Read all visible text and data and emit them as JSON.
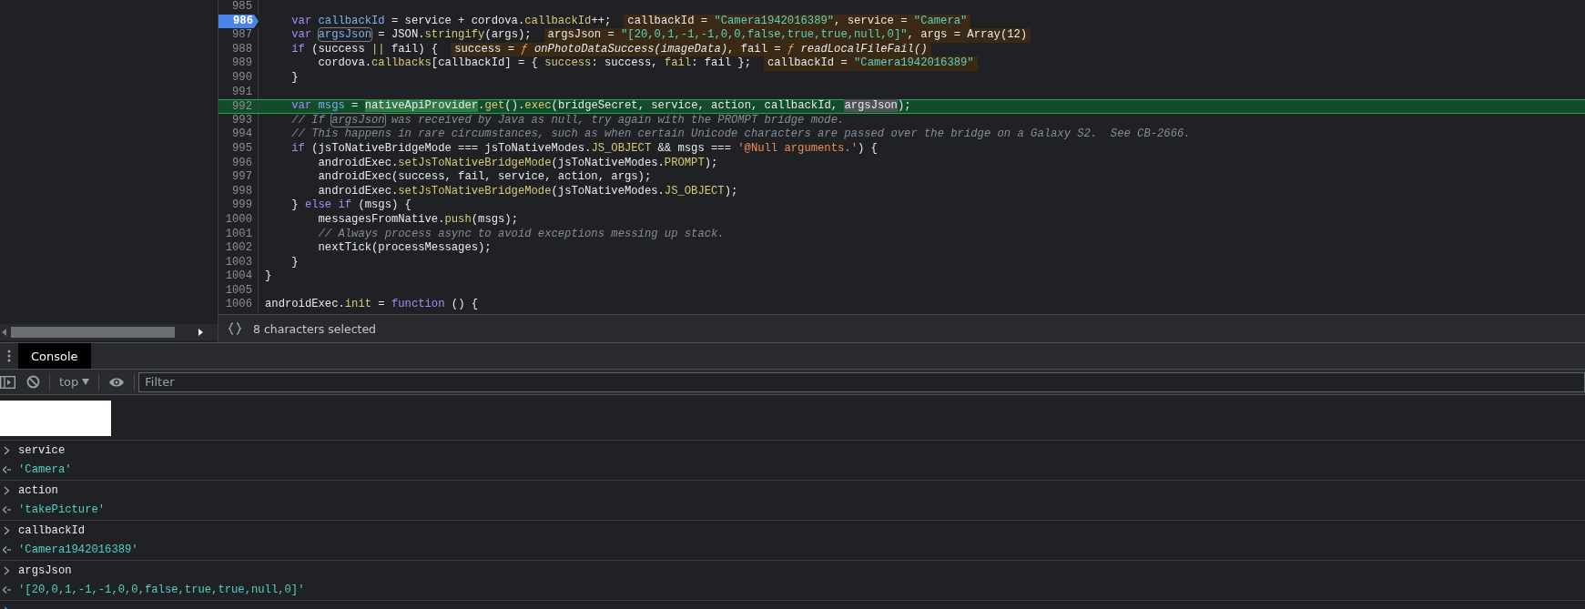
{
  "editor": {
    "lines": [
      {
        "number": "985",
        "breakpoint": false,
        "current": false
      },
      {
        "number": "986",
        "breakpoint": true,
        "current": false,
        "segments": [
          {
            "text": "    var ",
            "kind": "k"
          },
          {
            "text": "callbackId",
            "kind": "d"
          },
          {
            "text": " = service + cordova.",
            "kind": "p"
          },
          {
            "text": "callbackId",
            "kind": "y"
          },
          {
            "text": "++;",
            "kind": "p"
          }
        ],
        "inline": [
          {
            "text": "callbackId = ",
            "kind": "n"
          },
          {
            "text": "\"Camera1942016389\"",
            "kind": "t"
          },
          {
            "text": ", service = ",
            "kind": "n"
          },
          {
            "text": "\"Camera\"",
            "kind": "t"
          }
        ]
      },
      {
        "number": "987",
        "breakpoint": false,
        "current": false,
        "segments": [
          {
            "text": "    var ",
            "kind": "k"
          },
          {
            "text": "argsJson",
            "kind": "dm"
          },
          {
            "text": " = JSON.",
            "kind": "p"
          },
          {
            "text": "stringify",
            "kind": "y"
          },
          {
            "text": "(args);",
            "kind": "p"
          }
        ],
        "inline": [
          {
            "text": "argsJson = ",
            "kind": "n"
          },
          {
            "text": "\"[20,0,1,-1,-1,0,0,false,true,true,null,0]\"",
            "kind": "t"
          },
          {
            "text": ", args = Array(12)",
            "kind": "n"
          }
        ]
      },
      {
        "number": "988",
        "breakpoint": false,
        "current": false,
        "segments": [
          {
            "text": "    if",
            "kind": "k"
          },
          {
            "text": " (success ",
            "kind": "p"
          },
          {
            "text": "||",
            "kind": "y"
          },
          {
            "text": " fail) {",
            "kind": "p"
          }
        ],
        "inline": [
          {
            "text": "success = ",
            "kind": "n"
          },
          {
            "text": "ƒ ",
            "kind": "f"
          },
          {
            "text": "onPhotoDataSuccess(imageData)",
            "kind": "i"
          },
          {
            "text": ", fail = ",
            "kind": "n"
          },
          {
            "text": "ƒ ",
            "kind": "f"
          },
          {
            "text": "readLocalFileFail()",
            "kind": "i"
          }
        ]
      },
      {
        "number": "989",
        "breakpoint": false,
        "current": false,
        "segments": [
          {
            "text": "        cordova.",
            "kind": "p"
          },
          {
            "text": "callbacks",
            "kind": "y"
          },
          {
            "text": "[callbackId] = { ",
            "kind": "p"
          },
          {
            "text": "success",
            "kind": "y"
          },
          {
            "text": ": success, ",
            "kind": "p"
          },
          {
            "text": "fail",
            "kind": "y"
          },
          {
            "text": ": fail };",
            "kind": "p"
          }
        ],
        "inline": [
          {
            "text": "callbackId = ",
            "kind": "n"
          },
          {
            "text": "\"Camera1942016389\"",
            "kind": "t"
          }
        ]
      },
      {
        "number": "990",
        "breakpoint": false,
        "current": false,
        "segments": [
          {
            "text": "    }",
            "kind": "p"
          }
        ]
      },
      {
        "number": "991",
        "breakpoint": false,
        "current": false
      },
      {
        "number": "992",
        "breakpoint": false,
        "current": true,
        "segments": [
          {
            "text": "    var ",
            "kind": "k"
          },
          {
            "text": "msgs",
            "kind": "d"
          },
          {
            "text": " = ",
            "kind": "p"
          },
          {
            "text": "nativeApiProvider",
            "kind": "ph"
          },
          {
            "text": ".",
            "kind": "p"
          },
          {
            "text": "get",
            "kind": "y"
          },
          {
            "text": "().",
            "kind": "p"
          },
          {
            "text": "exec",
            "kind": "y"
          },
          {
            "text": "(bridgeSecret, service, action, callbackId, ",
            "kind": "p"
          },
          {
            "text": "argsJson",
            "kind": "ps"
          },
          {
            "text": ");",
            "kind": "p"
          }
        ]
      },
      {
        "number": "993",
        "breakpoint": false,
        "current": false,
        "segments": [
          {
            "text": "    // If ",
            "kind": "c"
          },
          {
            "text": "argsJson",
            "kind": "cm"
          },
          {
            "text": " was received by Java as null, try again with the PROMPT bridge mode.",
            "kind": "c"
          }
        ]
      },
      {
        "number": "994",
        "breakpoint": false,
        "current": false,
        "segments": [
          {
            "text": "    // This happens in rare circumstances, such as when certain Unicode characters are passed over the bridge on a Galaxy S2.  See CB-2666.",
            "kind": "c"
          }
        ]
      },
      {
        "number": "995",
        "breakpoint": false,
        "current": false,
        "segments": [
          {
            "text": "    if",
            "kind": "k"
          },
          {
            "text": " (jsToNativeBridgeMode === jsToNativeModes.",
            "kind": "p"
          },
          {
            "text": "JS_OBJECT",
            "kind": "y"
          },
          {
            "text": " && msgs === ",
            "kind": "p"
          },
          {
            "text": "'@Null arguments.'",
            "kind": "s"
          },
          {
            "text": ") {",
            "kind": "p"
          }
        ]
      },
      {
        "number": "996",
        "breakpoint": false,
        "current": false,
        "segments": [
          {
            "text": "        androidExec.",
            "kind": "p"
          },
          {
            "text": "setJsToNativeBridgeMode",
            "kind": "y"
          },
          {
            "text": "(jsToNativeModes.",
            "kind": "p"
          },
          {
            "text": "PROMPT",
            "kind": "y"
          },
          {
            "text": ");",
            "kind": "p"
          }
        ]
      },
      {
        "number": "997",
        "breakpoint": false,
        "current": false,
        "segments": [
          {
            "text": "        androidExec(success, fail, service, action, args);",
            "kind": "p"
          }
        ]
      },
      {
        "number": "998",
        "breakpoint": false,
        "current": false,
        "segments": [
          {
            "text": "        androidExec.",
            "kind": "p"
          },
          {
            "text": "setJsToNativeBridgeMode",
            "kind": "y"
          },
          {
            "text": "(jsToNativeModes.",
            "kind": "p"
          },
          {
            "text": "JS_OBJECT",
            "kind": "y"
          },
          {
            "text": ");",
            "kind": "p"
          }
        ]
      },
      {
        "number": "999",
        "breakpoint": false,
        "current": false,
        "segments": [
          {
            "text": "    } ",
            "kind": "p"
          },
          {
            "text": "else if",
            "kind": "k"
          },
          {
            "text": " (msgs) {",
            "kind": "p"
          }
        ]
      },
      {
        "number": "1000",
        "breakpoint": false,
        "current": false,
        "segments": [
          {
            "text": "        messagesFromNative.",
            "kind": "p"
          },
          {
            "text": "push",
            "kind": "y"
          },
          {
            "text": "(msgs);",
            "kind": "p"
          }
        ]
      },
      {
        "number": "1001",
        "breakpoint": false,
        "current": false,
        "segments": [
          {
            "text": "        // Always process async to avoid exceptions messing up stack.",
            "kind": "c"
          }
        ]
      },
      {
        "number": "1002",
        "breakpoint": false,
        "current": false,
        "segments": [
          {
            "text": "        nextTick(processMessages);",
            "kind": "p"
          }
        ]
      },
      {
        "number": "1003",
        "breakpoint": false,
        "current": false,
        "segments": [
          {
            "text": "    }",
            "kind": "p"
          }
        ]
      },
      {
        "number": "1004",
        "breakpoint": false,
        "current": false,
        "segments": [
          {
            "text": "}",
            "kind": "p"
          }
        ]
      },
      {
        "number": "1005",
        "breakpoint": false,
        "current": false
      },
      {
        "number": "1006",
        "breakpoint": false,
        "current": false,
        "segments": [
          {
            "text": "androidExec.",
            "kind": "p"
          },
          {
            "text": "init",
            "kind": "y"
          },
          {
            "text": " = ",
            "kind": "p"
          },
          {
            "text": "function",
            "kind": "k"
          },
          {
            "text": " () {",
            "kind": "p"
          }
        ]
      }
    ]
  },
  "status_bar": {
    "text": "8 characters selected"
  },
  "drawer": {
    "tabs": [
      {
        "label": "Console",
        "selected": true
      }
    ]
  },
  "console_toolbar": {
    "context": "top",
    "filter_placeholder": "Filter"
  },
  "console": {
    "entries": [
      {
        "input": "service",
        "result": "'Camera'"
      },
      {
        "input": "action",
        "result": "'takePicture'"
      },
      {
        "input": "callbackId",
        "result": "'Camera1942016389'"
      },
      {
        "input": "argsJson",
        "result": "'[20,0,1,-1,-1,0,0,false,true,true,null,0]'"
      }
    ]
  }
}
